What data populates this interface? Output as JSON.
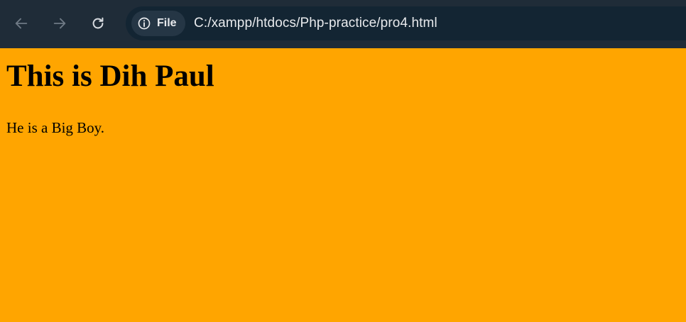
{
  "browser": {
    "back_icon": "arrow-left-icon",
    "forward_icon": "arrow-right-icon",
    "reload_icon": "reload-icon",
    "site_info_icon": "info-circle-icon",
    "site_info_label": "File",
    "url": "C:/xampp/htdocs/Php-practice/pro4.html"
  },
  "page": {
    "heading": "This is Dih Paul",
    "paragraph": "He is a Big Boy."
  },
  "colors": {
    "toolbar_bg": "#1f2c38",
    "omnibox_bg": "#132533",
    "page_bg": "#ffa500"
  }
}
